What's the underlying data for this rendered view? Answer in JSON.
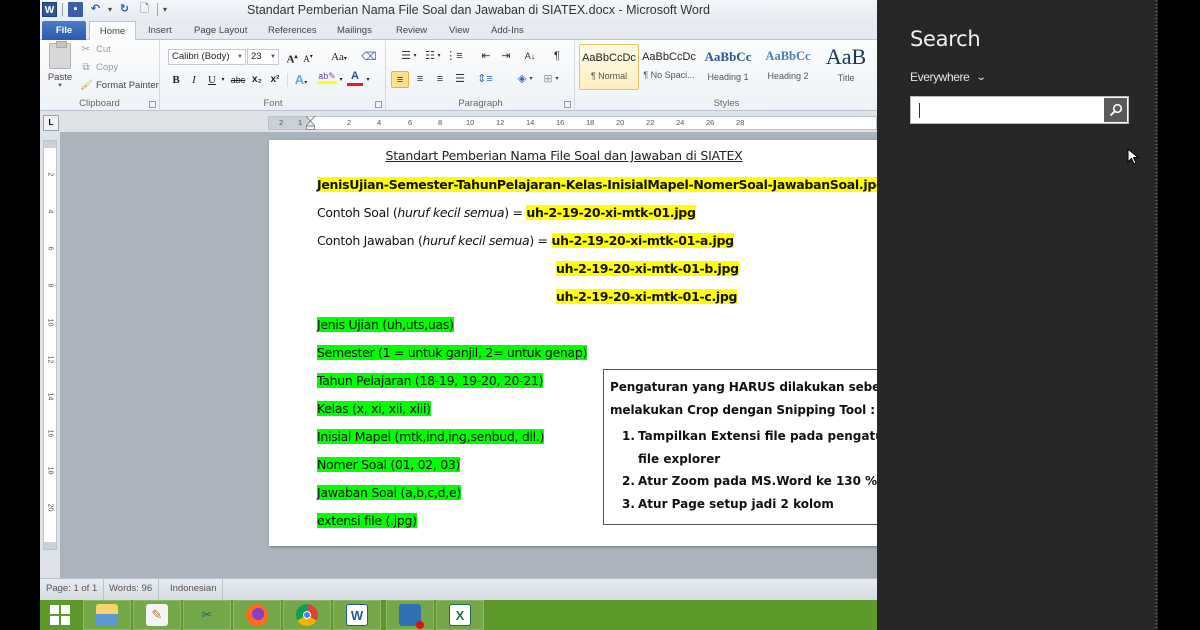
{
  "window": {
    "title": "Standart Pemberian Nama File Soal dan Jawaban di SIATEX.docx  -  Microsoft Word"
  },
  "quick_access": {
    "app_icon": "W",
    "icons": [
      "word-logo-icon",
      "save-icon",
      "undo-icon",
      "redo-icon",
      "print-preview-icon",
      "customize-toolbar-icon"
    ]
  },
  "tabs": [
    "File",
    "Home",
    "Insert",
    "Page Layout",
    "References",
    "Mailings",
    "Review",
    "View",
    "Add-Ins"
  ],
  "active_tab": "Home",
  "ribbon": {
    "clipboard": {
      "label": "Clipboard",
      "paste": "Paste",
      "cut": "Cut",
      "copy": "Copy",
      "format_painter": "Format Painter"
    },
    "font": {
      "label": "Font",
      "font_name": "Calibri (Body)",
      "font_size": "23",
      "grow": "A",
      "shrink": "A",
      "change_case": "Aa",
      "bold": "B",
      "italic": "I",
      "underline": "U",
      "strikethrough": "abc",
      "subscript": "x₂",
      "superscript": "x²",
      "highlight_color": "#ffff00",
      "font_color": "#e02020"
    },
    "paragraph": {
      "label": "Paragraph",
      "active_alignment": "align-left"
    },
    "styles": {
      "label": "Styles",
      "items": [
        {
          "sample": "AaBbCcDc",
          "name": "¶ Normal",
          "active": true
        },
        {
          "sample": "AaBbCcDc",
          "name": "¶ No Spaci...",
          "active": false
        },
        {
          "sample": "AaBbCc",
          "name": "Heading 1",
          "active": false
        },
        {
          "sample": "AaBbCc",
          "name": "Heading 2",
          "active": false
        },
        {
          "sample": "AaB",
          "name": "Title",
          "active": false
        }
      ]
    }
  },
  "ruler": {
    "horizontal_labels": [
      "2",
      "1",
      "2",
      "4",
      "6",
      "8",
      "10",
      "12",
      "14",
      "16",
      "18",
      "20",
      "22",
      "24",
      "26",
      "28"
    ],
    "vertical_labels": [
      "2",
      "4",
      "6",
      "8",
      "10",
      "12",
      "14",
      "16",
      "18",
      "20"
    ]
  },
  "document": {
    "title": "Standart Pemberian Nama File Soal dan Jawaban di SIATEX",
    "format_line": "JenisUjian-Semester-TahunPelajaran-Kelas-InisialMapel-NomerSoal-JawabanSoal.jpg",
    "soal_example": {
      "prefix": "Contoh Soal (",
      "italic": "huruf kecil semua",
      "suffix": ") = ",
      "value": "uh-2-19-20-xi-mtk-01.jpg"
    },
    "jawaban_example": {
      "prefix": "Contoh Jawaban (",
      "italic": "huruf kecil semua",
      "suffix": ") = ",
      "values": [
        "uh-2-19-20-xi-mtk-01-a.jpg",
        "uh-2-19-20-xi-mtk-01-b.jpg",
        "uh-2-19-20-xi-mtk-01-c.jpg"
      ]
    },
    "legend_items": [
      "Jenis Ujian (uh,uts,uas)",
      "Semester (1 = untuk ganjil, 2= untuk genap)",
      "Tahun Pelajaran (18-19, 19-20, 20-21)",
      "Kelas (x, xi, xii, xiii)",
      "Inisial Mapel (mtk,ind,ing,senbud, dll.)",
      "Nomer Soal (01, 02, 03)",
      "Jawaban Soal (a,b,c,d,e)",
      "extensi file (.jpg)"
    ],
    "info_box": {
      "heading_line1": "Pengaturan yang HARUS dilakukan sebelum",
      "heading_line2": "melakukan Crop dengan Snipping Tool :",
      "steps": [
        {
          "num": "1.",
          "line1": "Tampilkan  Extensi file pada  pengaturan",
          "line2": "file explorer"
        },
        {
          "num": "2.",
          "line1": "Atur Zoom pada MS.Word ke 130 %",
          "line2": ""
        },
        {
          "num": "3.",
          "line1": "Atur Page setup jadi 2 kolom",
          "line2": ""
        }
      ]
    },
    "highlight_yellow": "#ffff00",
    "highlight_green": "#00ff00"
  },
  "status_bar": {
    "page": "Page: 1 of 1",
    "words": "Words: 96",
    "language": "Indonesian"
  },
  "taskbar": {
    "items": [
      "start",
      "file-explorer",
      "notepad",
      "snipping-tool",
      "firefox",
      "chrome",
      "word",
      "remote-desktop",
      "excel"
    ],
    "color": "#5e9a2b"
  },
  "charm_search": {
    "title": "Search",
    "scope": "Everywhere",
    "input_value": "",
    "input_placeholder": ""
  }
}
